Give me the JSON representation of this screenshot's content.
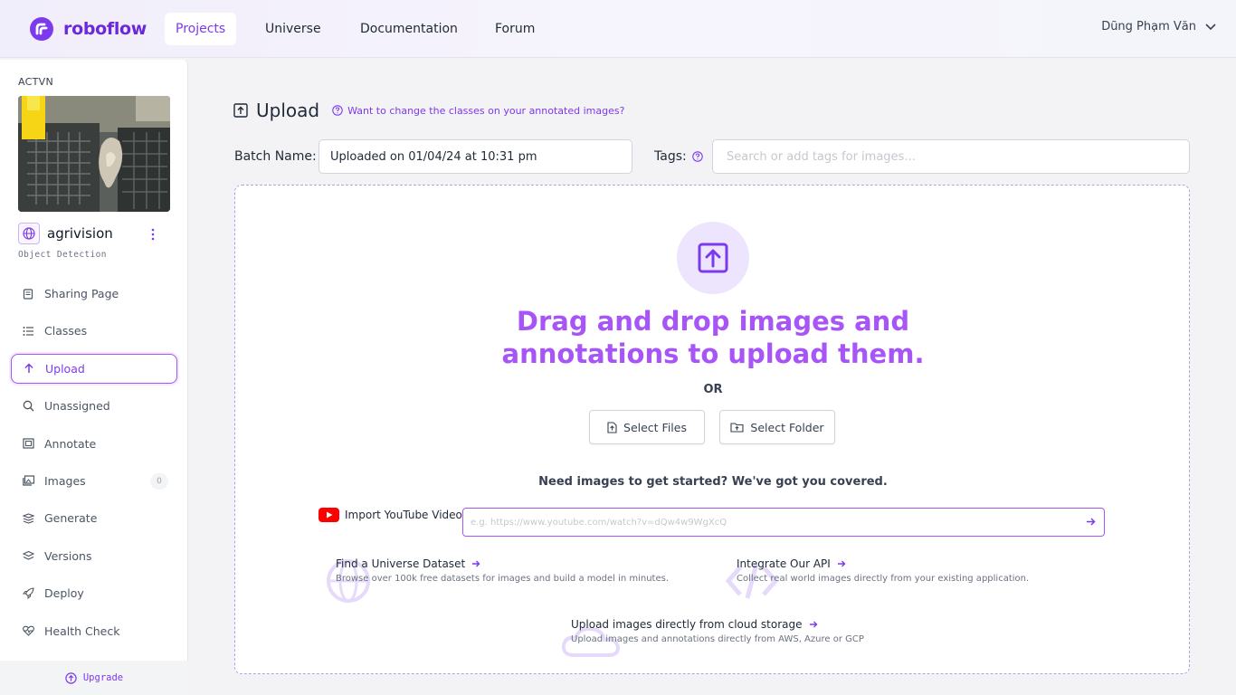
{
  "brand": {
    "name": "roboflow"
  },
  "nav": {
    "items": [
      {
        "label": "Projects"
      },
      {
        "label": "Universe"
      },
      {
        "label": "Documentation"
      },
      {
        "label": "Forum"
      }
    ],
    "user_name": "Dũng Phạm Văn"
  },
  "sidebar": {
    "workspace": "ACTVN",
    "project_name": "agrivision",
    "project_type": "Object Detection",
    "items": [
      {
        "label": "Sharing Page",
        "icon": "page-icon"
      },
      {
        "label": "Classes",
        "icon": "list-icon"
      },
      {
        "label": "Upload",
        "icon": "arrow-up-icon"
      },
      {
        "label": "Unassigned",
        "icon": "search-icon"
      },
      {
        "label": "Annotate",
        "icon": "annotate-icon"
      },
      {
        "label": "Images",
        "icon": "images-icon",
        "count": "0"
      },
      {
        "label": "Generate",
        "icon": "generate-icon"
      },
      {
        "label": "Versions",
        "icon": "versions-icon"
      },
      {
        "label": "Deploy",
        "icon": "rocket-icon"
      },
      {
        "label": "Health Check",
        "icon": "heart-pulse-icon"
      }
    ],
    "upgrade_label": "Upgrade"
  },
  "main": {
    "title": "Upload",
    "help_link": "Want to change the classes on your annotated images?",
    "batch_label": "Batch Name:",
    "batch_value": "Uploaded on 01/04/24 at 10:31 pm",
    "tags_label": "Tags:",
    "tags_placeholder": "Search or add tags for images...",
    "dropzone": {
      "title_line1": "Drag and drop images and",
      "title_line2": "annotations to upload them.",
      "or": "OR",
      "select_files": "Select Files",
      "select_folder": "Select Folder",
      "need_images": "Need images to get started? We've got you covered.",
      "youtube_label": "Import YouTube Video:",
      "youtube_placeholder": "e.g. https://www.youtube.com/watch?v=dQw4w9WgXcQ",
      "options": [
        {
          "title": "Find a Universe Dataset",
          "desc": "Browse over 100k free datasets for images and build a model in minutes."
        },
        {
          "title": "Integrate Our API",
          "desc": "Collect real world images directly from your existing application."
        },
        {
          "title": "Upload images directly from cloud storage",
          "desc": "Upload images and annotations directly from AWS, Azure or GCP"
        }
      ]
    }
  },
  "colors": {
    "accent": "#7c3aed",
    "accent_light": "#a855f7",
    "youtube_red": "#ff0000"
  }
}
